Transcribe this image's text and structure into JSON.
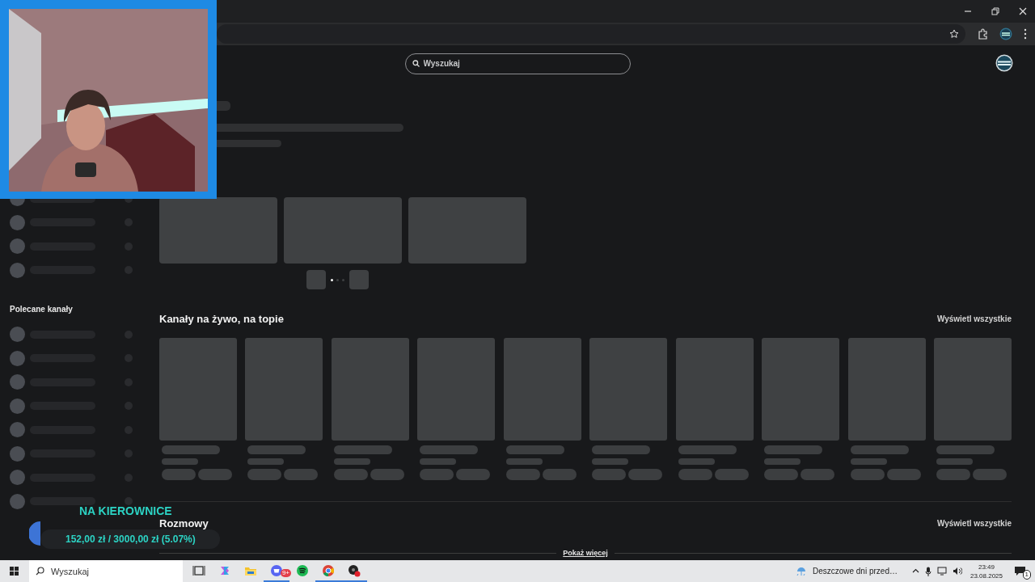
{
  "header": {
    "search": {
      "placeholder": "Wyszukaj"
    }
  },
  "sidebar": {
    "top_rows": [
      {
        "kind": "placeholder"
      },
      {
        "kind": "placeholder"
      },
      {
        "kind": "placeholder"
      },
      {
        "kind": "placeholder"
      }
    ],
    "recommended": {
      "title": "Polecane kanały",
      "rows": [
        {
          "kind": "placeholder"
        },
        {
          "kind": "placeholder"
        },
        {
          "kind": "placeholder"
        },
        {
          "kind": "placeholder"
        },
        {
          "kind": "placeholder"
        },
        {
          "kind": "placeholder"
        },
        {
          "kind": "placeholder"
        },
        {
          "kind": "placeholder"
        }
      ]
    }
  },
  "hero": {
    "slides": [
      {
        "kind": "placeholder"
      },
      {
        "kind": "placeholder"
      },
      {
        "kind": "placeholder"
      }
    ],
    "dots": [
      {
        "selected": true
      },
      {
        "selected": false
      },
      {
        "selected": false
      }
    ]
  },
  "sections": [
    {
      "title": "Kanały na żywo, na topie",
      "view_all": "Wyświetl wszystkie",
      "cards": [
        {
          "kind": "placeholder"
        },
        {
          "kind": "placeholder"
        },
        {
          "kind": "placeholder"
        },
        {
          "kind": "placeholder"
        },
        {
          "kind": "placeholder"
        },
        {
          "kind": "placeholder"
        },
        {
          "kind": "placeholder"
        },
        {
          "kind": "placeholder"
        },
        {
          "kind": "placeholder"
        },
        {
          "kind": "placeholder"
        }
      ]
    },
    {
      "title": "Rozmowy",
      "view_all": "Wyświetl wszystkie"
    }
  ],
  "show_more": "Pokaż więcej",
  "overlay": {
    "goal_title": "NA KIEROWNICE",
    "goal_amount": "152,00 zł / 3000,00 zł (5.07%)"
  },
  "taskbar": {
    "search": {
      "placeholder": "Wyszukaj"
    },
    "apps": [
      {
        "kind": "task-view",
        "active": false
      },
      {
        "kind": "copilot",
        "active": false
      },
      {
        "kind": "files",
        "active": false
      },
      {
        "kind": "discord",
        "active": true,
        "badge": "9+"
      },
      {
        "kind": "spotify",
        "active": false
      },
      {
        "kind": "chrome",
        "active": true
      },
      {
        "kind": "recorder",
        "active": true
      }
    ],
    "weather": "Deszczowe dni przed…",
    "time": "23:49",
    "date": "23.08.2025",
    "notifications": "1"
  }
}
